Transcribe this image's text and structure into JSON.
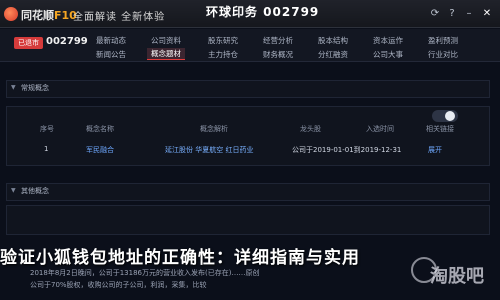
{
  "app": {
    "brand_main": "同花顺",
    "brand_accent": "F10",
    "title": "全面解读 全新体验",
    "stock_title": "环球印务 002799",
    "stock_subtitle": "同花顺F10 全面解读 全新体验"
  },
  "stock": {
    "badge": "已退市",
    "code": "002799"
  },
  "nav_row1": [
    "最新动态",
    "公司资料",
    "股东研究",
    "经营分析",
    "股本结构",
    "资本运作",
    "盈利预测"
  ],
  "nav_row2": [
    "新闻公告",
    "概念题材",
    "主力持仓",
    "财务概况",
    "分红融资",
    "公司大事",
    "行业对比"
  ],
  "selected_nav": "概念题材",
  "panels": {
    "regular_label": "常规概念",
    "other_label": "其他概念"
  },
  "table": {
    "headers": [
      "序号",
      "概念名称",
      "概念解析",
      "龙头股",
      "入选时间",
      "相关链接"
    ],
    "rows": [
      {
        "index": "1",
        "name": "军民融合",
        "leaders": "延江股份 华夏航空 红日药业",
        "added": "公司于2019-01-01到2019-12-31",
        "action": "展开"
      }
    ]
  },
  "headline": "验证小狐钱包地址的正确性：详细指南与实用",
  "footer": {
    "line": "2018年8月2日晚间，公司于13186万元的营业收入发布(已存在)……原创",
    "line2": "公司于70%股权，收购公司的子公司，利润，采集，比较",
    "watermark": "淘股吧"
  },
  "colors": {
    "accent_red": "#e23c3c",
    "link_blue": "#6ea8ff",
    "brand_orange": "#f5a623"
  },
  "icons": [
    "logo-icon",
    "refresh-icon",
    "help-icon",
    "minimize-icon",
    "close-icon",
    "caret-down-icon",
    "toggle-switch"
  ]
}
